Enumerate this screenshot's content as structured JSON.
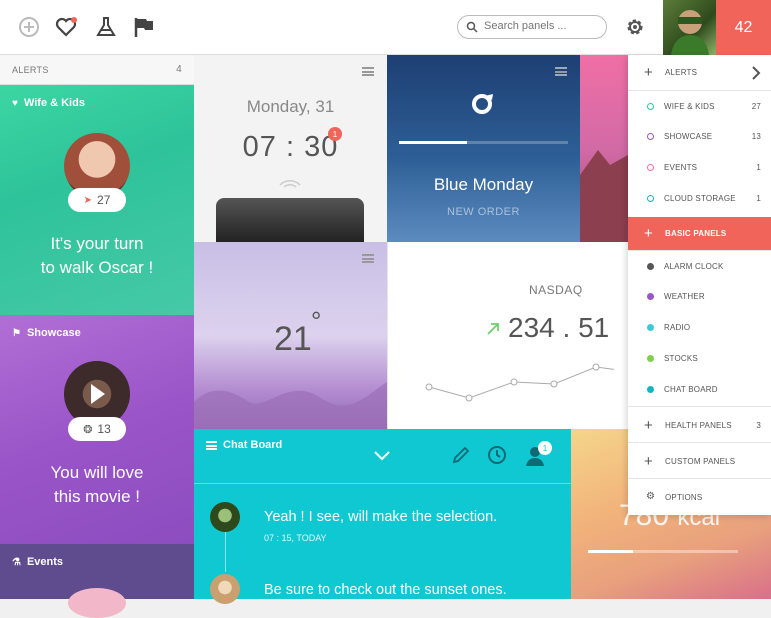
{
  "topbar": {
    "search_placeholder": "Search panels ...",
    "notification_count": "42",
    "icons": [
      "add-icon",
      "heart-icon",
      "flask-icon",
      "flag-icon",
      "search-icon",
      "gear-icon"
    ]
  },
  "alerts_header": {
    "label": "ALERTS",
    "count": "4"
  },
  "wife_card": {
    "title": "Wife & Kids",
    "pill_count": "27",
    "message_line1": "It's your turn",
    "message_line2": "to walk Oscar !"
  },
  "showcase_card": {
    "title": "Showcase",
    "pill_count": "13",
    "message_line1": "You will love",
    "message_line2": "this movie !"
  },
  "events_card": {
    "title": "Events"
  },
  "clock_card": {
    "date": "Monday, 31",
    "time": "07 : 30",
    "badge": "1"
  },
  "blue_card": {
    "title": "Blue Monday",
    "subtitle": "NEW ORDER",
    "progress": 0.4
  },
  "weather_card": {
    "temp": "21",
    "degree": "°"
  },
  "nasdaq_card": {
    "label": "NASDAQ",
    "value": "234.51",
    "value_int": "234",
    "value_dec": "51",
    "trend_color": "#6fcf6f"
  },
  "chat_card": {
    "title": "Chat Board",
    "badge": "1",
    "messages": [
      {
        "text": "Yeah ! I see, will make the selection.",
        "time": "07 : 15, TODAY"
      },
      {
        "text": "Be sure to check out the sunset ones.",
        "time": ""
      }
    ]
  },
  "calorie_card": {
    "value": "780",
    "unit": "kcal",
    "progress": 0.3
  },
  "right_menu": {
    "alerts": "ALERTS",
    "items_alerts": [
      {
        "label": "WIFE & KIDS",
        "count": "27",
        "color": "#2ec39a"
      },
      {
        "label": "SHOWCASE",
        "count": "13",
        "color": "#9a55c8"
      },
      {
        "label": "EVENTS",
        "count": "1",
        "color": "#f06fa5"
      },
      {
        "label": "CLOUD STORAGE",
        "count": "1",
        "color": "#10b5c8"
      }
    ],
    "basic_panels": "BASIC PANELS",
    "items_basic": [
      {
        "label": "ALARM CLOCK",
        "color": "#555555"
      },
      {
        "label": "WEATHER",
        "color": "#9a55c8"
      },
      {
        "label": "RADIO",
        "color": "#3ec9d6"
      },
      {
        "label": "STOCKS",
        "color": "#7fd04b"
      },
      {
        "label": "CHAT BOARD",
        "color": "#10b5c8"
      }
    ],
    "health_panels": "HEALTH PANELS",
    "health_count": "3",
    "custom_panels": "CUSTOM PANELS",
    "options": "OPTIONS",
    "accent": "#f0645a"
  }
}
